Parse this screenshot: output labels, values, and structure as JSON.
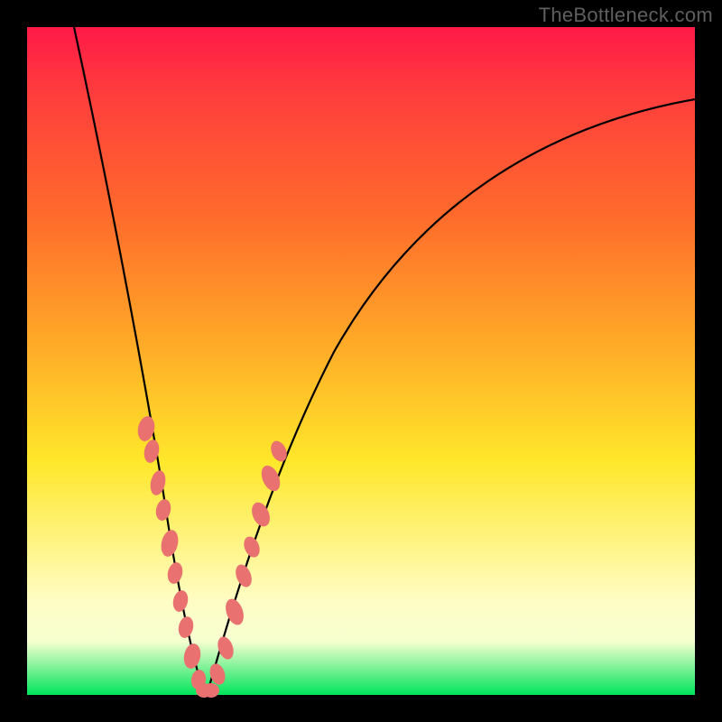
{
  "watermark": "TheBottleneck.com",
  "colors": {
    "gradient_top": "#ff1a47",
    "gradient_mid1": "#ff6a2c",
    "gradient_mid2": "#ffe72a",
    "gradient_pale": "#fffdc5",
    "gradient_bottom": "#00e45b",
    "frame": "#000000",
    "curve": "#000000",
    "beads": "#e9716f"
  },
  "chart_data": {
    "type": "line",
    "title": "",
    "xlabel": "",
    "ylabel": "",
    "xlim": [
      0,
      100
    ],
    "ylim": [
      0,
      100
    ],
    "notes": "Two curved branches plunging to a common minimum near x≈26, y≈0. Axes unlabeled; values estimated from pixel positions with origin at bottom-left of colored area.",
    "grid": false,
    "legend": false,
    "series": [
      {
        "name": "left-branch",
        "x": [
          7,
          10,
          13,
          16,
          19,
          21,
          23,
          25,
          26
        ],
        "y": [
          100,
          82,
          63,
          45,
          29,
          18,
          10,
          3,
          0
        ]
      },
      {
        "name": "right-branch",
        "x": [
          26,
          28,
          30,
          33,
          37,
          43,
          52,
          64,
          80,
          100
        ],
        "y": [
          0,
          4,
          10,
          20,
          33,
          48,
          62,
          74,
          83,
          89
        ]
      }
    ],
    "markers": [
      {
        "name": "beads-left",
        "shape": "rounded",
        "color": "#e9716f",
        "points_xy": [
          [
            17.8,
            40
          ],
          [
            18.3,
            37
          ],
          [
            19.6,
            31
          ],
          [
            20.3,
            27
          ],
          [
            21.3,
            22
          ],
          [
            22.0,
            18
          ],
          [
            22.7,
            14
          ],
          [
            23.6,
            10
          ],
          [
            24.5,
            5
          ],
          [
            25.2,
            2
          ],
          [
            26.0,
            0.5
          ]
        ]
      },
      {
        "name": "beads-right",
        "shape": "rounded",
        "color": "#e9716f",
        "points_xy": [
          [
            27.2,
            0.5
          ],
          [
            28.2,
            3
          ],
          [
            29.2,
            7
          ],
          [
            30.6,
            13
          ],
          [
            31.9,
            19
          ],
          [
            33.1,
            23
          ],
          [
            34.3,
            28
          ],
          [
            35.9,
            33
          ],
          [
            37.0,
            37
          ]
        ]
      }
    ]
  }
}
